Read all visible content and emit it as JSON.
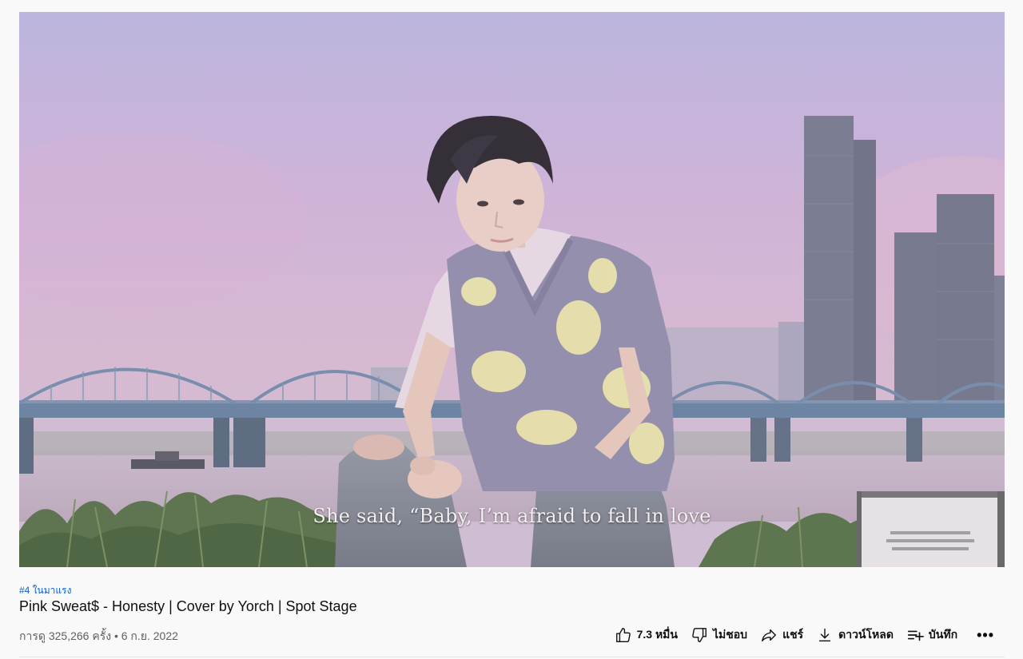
{
  "video": {
    "caption": "She said, “Baby, I’m afraid to fall in love"
  },
  "meta": {
    "trending_badge": "#4 ในมาแรง",
    "title": "Pink Sweat$ - Honesty | Cover by Yorch | Spot Stage",
    "views_line": "การดู 325,266 ครั้ง • 6 ก.ย. 2022"
  },
  "actions": {
    "like_label": "7.3 หมื่น",
    "dislike_label": "ไม่ชอบ",
    "share_label": "แชร์",
    "download_label": "ดาวน์โหลด",
    "save_label": "บันทึก",
    "more_label": "•••"
  },
  "icons": {
    "like": "thumbs-up-icon",
    "dislike": "thumbs-down-icon",
    "share": "share-arrow-icon",
    "download": "download-icon",
    "save": "playlist-add-icon",
    "more": "more-horizontal-icon"
  },
  "colors": {
    "link_blue": "#065fd4",
    "text_primary": "#0f0f0f",
    "text_secondary": "#606060",
    "page_background": "#f9f9f9"
  }
}
